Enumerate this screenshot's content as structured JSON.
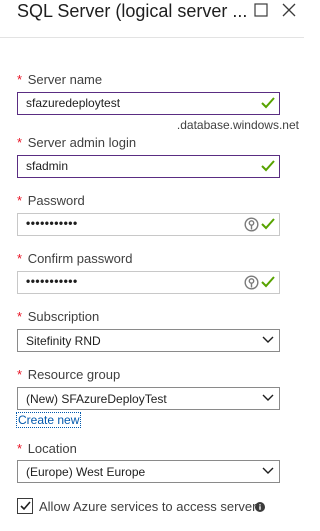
{
  "blade": {
    "title": "SQL Server (logical server ...",
    "maximize_icon": "maximize-icon",
    "close_icon": "close-icon"
  },
  "required_marker": "*",
  "fields": {
    "server_name": {
      "label": "Server name",
      "value": "sfazuredeploytest",
      "suffix": ".database.windows.net",
      "valid": true
    },
    "admin_login": {
      "label": "Server admin login",
      "value": "sfadmin",
      "valid": true
    },
    "password": {
      "label": "Password",
      "value": "•••••••••••",
      "valid": true
    },
    "confirm_password": {
      "label": "Confirm password",
      "value": "•••••••••••",
      "valid": true
    },
    "subscription": {
      "label": "Subscription",
      "selected": "Sitefinity RND"
    },
    "resource_group": {
      "label": "Resource group",
      "selected": "(New) SFAzureDeployTest",
      "create_new_link": "Create new"
    },
    "location": {
      "label": "Location",
      "selected": "(Europe) West Europe"
    }
  },
  "allow_azure": {
    "label": "Allow Azure services to access server",
    "checked": true
  },
  "colors": {
    "accent_focus": "#5a2d82",
    "valid_check": "#57a300",
    "required": "#e81123",
    "link": "#0058ad"
  }
}
